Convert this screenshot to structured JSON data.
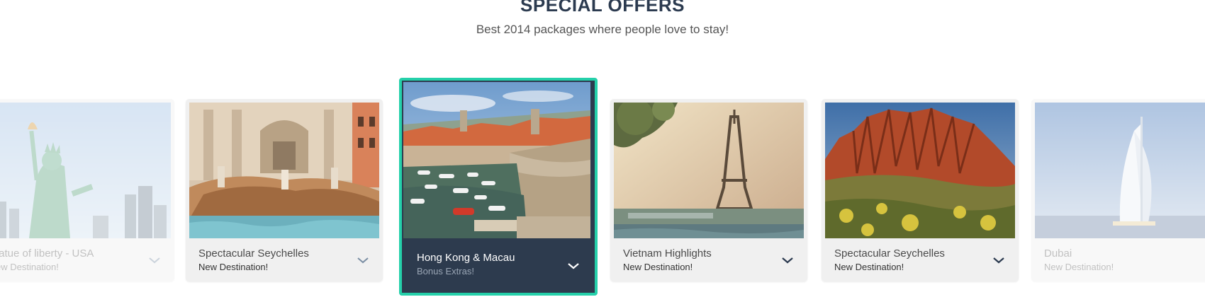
{
  "header": {
    "title": "SPECIAL OFFERS",
    "subtitle": "Best 2014 packages where people love to stay!"
  },
  "offers": [
    {
      "name": "tatue of liberty - USA",
      "tag": "ew Destination!",
      "image": "statue-of-liberty-photo",
      "state": "faded"
    },
    {
      "name": "Spectacular Seychelles",
      "tag": "New Destination!",
      "image": "trevi-fountain-photo",
      "state": "normal"
    },
    {
      "name": "Hong Kong & Macau",
      "tag": "Bonus Extras!",
      "image": "harbor-old-town-photo",
      "state": "active"
    },
    {
      "name": "Vietnam Highlights",
      "tag": "New Destination!",
      "image": "eiffel-tower-photo",
      "state": "normal"
    },
    {
      "name": "Spectacular Seychelles",
      "tag": "New Destination!",
      "image": "red-rock-mountains-photo",
      "state": "normal"
    },
    {
      "name": "Dubai",
      "tag": "New Destination!",
      "image": "burj-al-arab-photo",
      "state": "faded"
    }
  ],
  "colors": {
    "title": "#2b3a4f",
    "active_border": "#25d0aa",
    "active_panel": "#2d3b4e",
    "card_bg": "#f0f0f0"
  },
  "icons": {
    "expand": "chevron-down-icon"
  }
}
